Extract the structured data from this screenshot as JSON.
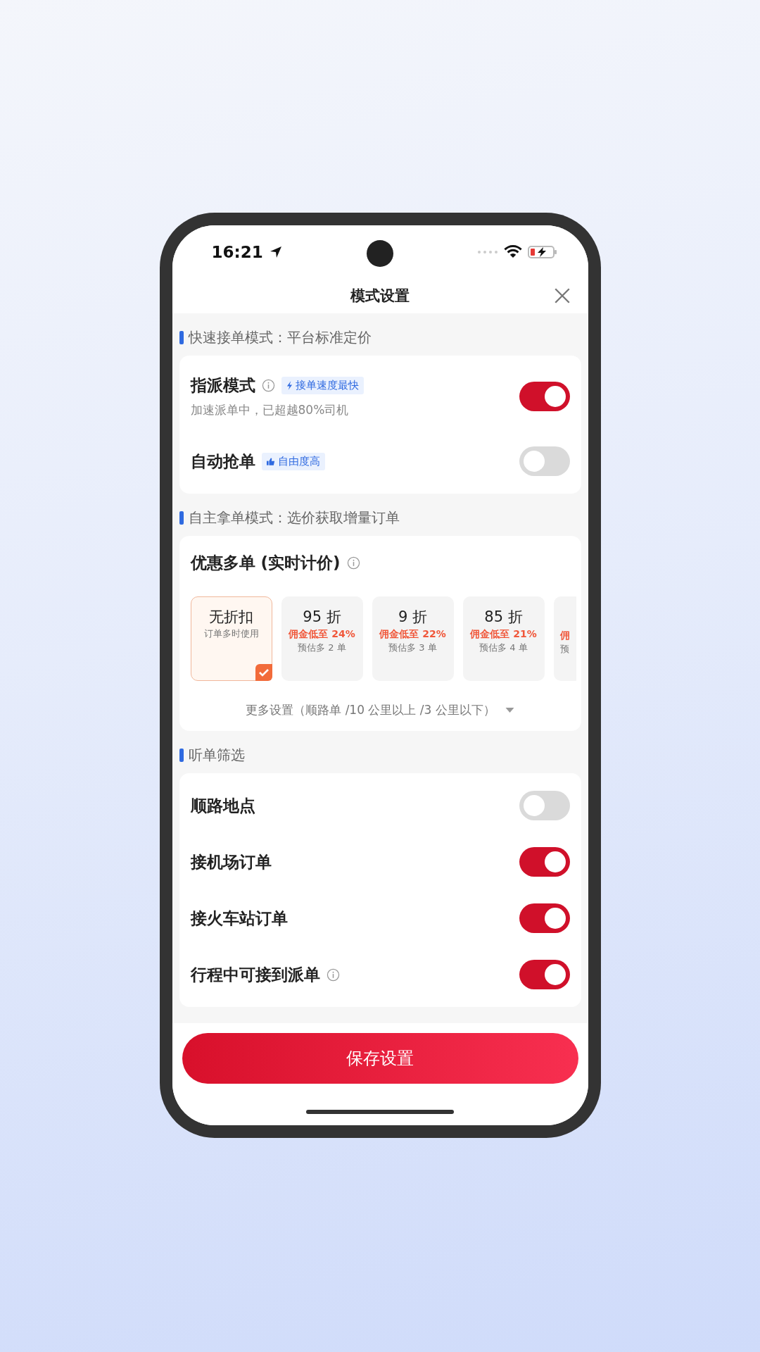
{
  "status_bar": {
    "time": "16:21"
  },
  "header": {
    "title": "模式设置"
  },
  "sections": [
    {
      "title": "快速接单模式：平台标准定价",
      "kind": "toggles",
      "rows": [
        {
          "label": "指派模式",
          "info": true,
          "tag": {
            "kind": "speed",
            "text": "接单速度最快"
          },
          "subtitle": "加速派单中，已超越80%司机",
          "on": true
        },
        {
          "label": "自动抢单",
          "info": false,
          "tag": {
            "kind": "freedom",
            "text": "自由度高"
          },
          "on": false
        }
      ]
    },
    {
      "title": "自主拿单模式：选价获取增量订单",
      "kind": "discount",
      "heading": "优惠多单 (实时计价)",
      "info": true,
      "options": [
        {
          "title": "无折扣",
          "note": "订单多时使用",
          "selected": true
        },
        {
          "title": "95 折",
          "commission": "佣金低至 24%",
          "estimate": "预估多 2 单",
          "selected": false
        },
        {
          "title": "9 折",
          "commission": "佣金低至 22%",
          "estimate": "预估多 3 单",
          "selected": false
        },
        {
          "title": "85 折",
          "commission": "佣金低至 21%",
          "estimate": "预估多 4 单",
          "selected": false
        },
        {
          "commission": "佣",
          "estimate": "预",
          "selected": false
        }
      ],
      "more": "更多设置（顺路单 /10 公里以上 /3 公里以下）"
    },
    {
      "title": "听单筛选",
      "kind": "toggles",
      "rows": [
        {
          "label": "顺路地点",
          "info": false,
          "on": false
        },
        {
          "label": "接机场订单",
          "info": false,
          "on": true
        },
        {
          "label": "接火车站订单",
          "info": false,
          "on": true
        },
        {
          "label": "行程中可接到派单",
          "info": true,
          "on": true
        }
      ]
    }
  ],
  "save_button": "保存设置"
}
